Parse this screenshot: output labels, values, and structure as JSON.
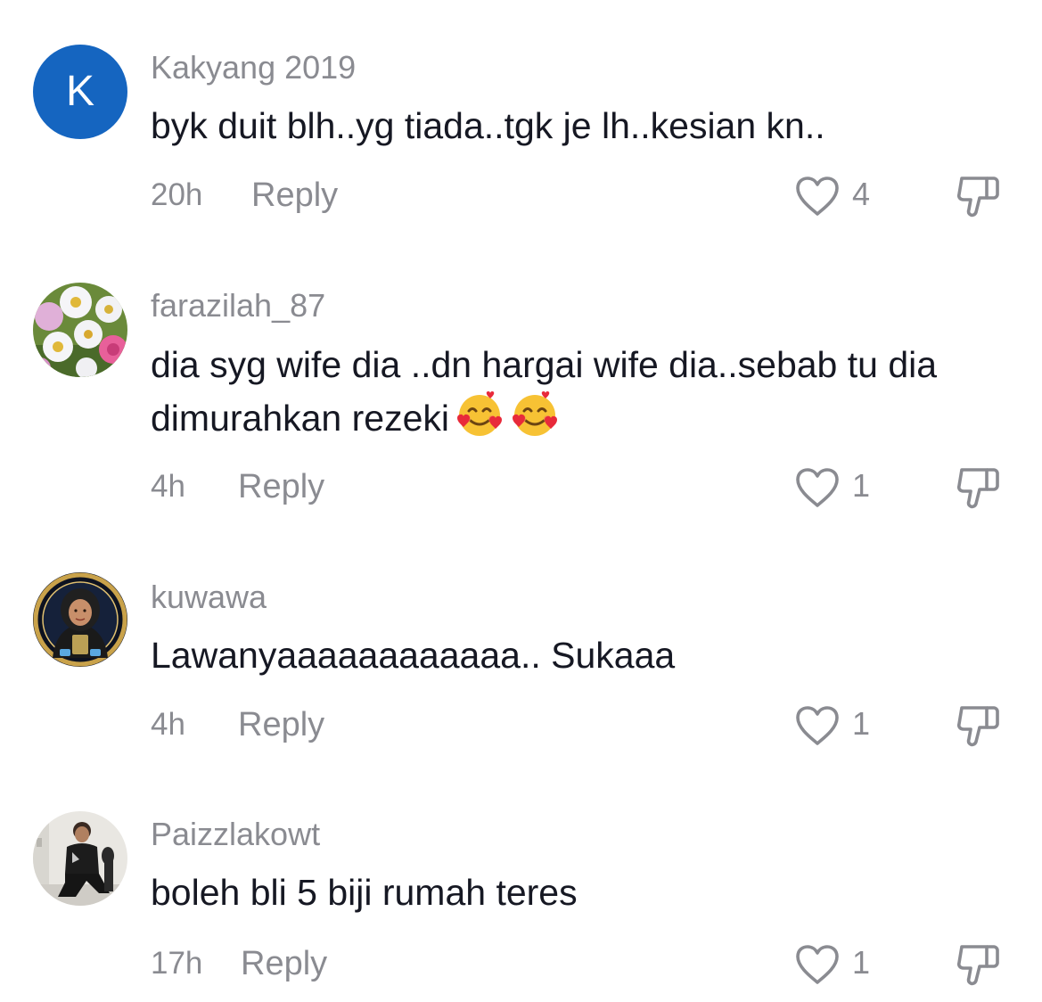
{
  "comments": [
    {
      "avatar_letter": "K",
      "avatar_color": "#1565c0",
      "username": "Kakyang 2019",
      "text": "byk duit blh..yg tiada..tgk je lh..kesian kn..",
      "time": "20h",
      "reply_label": "Reply",
      "like_count": "4",
      "like_icon": "heart-outline-icon",
      "dislike_icon": "thumbs-down-icon"
    },
    {
      "avatar_image": "flower-bouquet-image",
      "username": "farazilah_87",
      "text": "dia syg wife dia ..dn hargai wife dia..sebab tu dia dimurahkan rezeki",
      "emoji": [
        "smiling-face-with-hearts-emoji",
        "smiling-face-with-hearts-emoji"
      ],
      "time": "4h",
      "reply_label": "Reply",
      "like_count": "1",
      "like_icon": "heart-outline-icon",
      "dislike_icon": "thumbs-down-icon"
    },
    {
      "avatar_image": "hijab-woman-badge-image",
      "username": "kuwawa",
      "text": "Lawanyaaaaaaaaaaaa.. Sukaaa",
      "time": "4h",
      "reply_label": "Reply",
      "like_count": "1",
      "like_icon": "heart-outline-icon",
      "dislike_icon": "thumbs-down-icon"
    },
    {
      "avatar_image": "man-sitting-photo-image",
      "username": "Paizzlakowt",
      "text": "boleh bli 5 biji rumah teres",
      "time": "17h",
      "reply_label": "Reply",
      "like_count": "1",
      "like_icon": "heart-outline-icon",
      "dislike_icon": "thumbs-down-icon"
    }
  ],
  "colors": {
    "text_primary": "#161823",
    "text_secondary": "#8a8b91",
    "background": "#ffffff"
  }
}
